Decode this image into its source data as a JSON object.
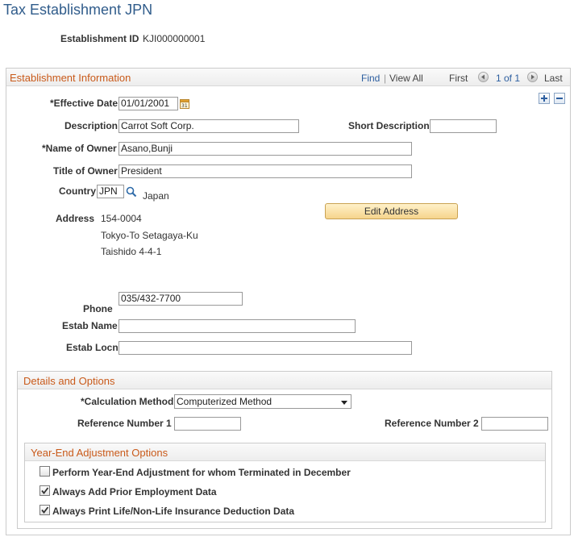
{
  "page": {
    "title": "Tax Establishment JPN"
  },
  "establishment": {
    "id_label": "Establishment ID",
    "id_value": "KJI000000001"
  },
  "info_section": {
    "title": "Establishment Information",
    "nav": {
      "find": "Find",
      "separator": "|",
      "view_all": "View All",
      "first": "First",
      "count": "1 of 1",
      "last": "Last"
    },
    "effective_date": {
      "label": "*Effective Date",
      "value": "01/01/2001"
    },
    "description": {
      "label": "Description",
      "value": "Carrot Soft Corp."
    },
    "short_description": {
      "label": "Short Description",
      "value": ""
    },
    "owner_name": {
      "label": "*Name of Owner",
      "value": "Asano,Bunji"
    },
    "owner_title": {
      "label": "Title of Owner",
      "value": "President"
    },
    "country": {
      "label": "Country",
      "code": "JPN",
      "name": "Japan"
    },
    "address": {
      "label": "Address",
      "lines": [
        "154-0004",
        "Tokyo-To Setagaya-Ku",
        "Taishido 4-4-1"
      ]
    },
    "edit_address_button": "Edit Address",
    "phone": {
      "label": "Phone",
      "value": "035/432-7700"
    },
    "estab_name": {
      "label": "Estab Name",
      "value": ""
    },
    "estab_locn": {
      "label": "Estab Locn",
      "value": ""
    }
  },
  "details_section": {
    "title": "Details and Options",
    "calculation_method": {
      "label": "*Calculation Method",
      "value": "Computerized Method"
    },
    "reference_number_1": {
      "label": "Reference Number 1",
      "value": ""
    },
    "reference_number_2": {
      "label": "Reference Number 2",
      "value": ""
    }
  },
  "year_end_section": {
    "title": "Year-End Adjustment Options",
    "options": [
      {
        "label": "Perform Year-End Adjustment for whom Terminated in December",
        "checked": false
      },
      {
        "label": "Always Add Prior Employment Data",
        "checked": true
      },
      {
        "label": "Always Print Life/Non-Life Insurance Deduction Data",
        "checked": true
      }
    ]
  },
  "icons": {
    "calendar": "calendar-icon",
    "lookup": "magnifier-icon",
    "add_row": "plus-icon",
    "delete_row": "minus-icon",
    "prev": "triangle-left-icon",
    "next": "triangle-right-icon",
    "dropdown": "triangle-down-icon",
    "check": "check-icon"
  },
  "colors": {
    "title": "#305c8b",
    "section_title": "#c95a1a",
    "link": "#2d5fa0",
    "button_fill": "#f6d48c"
  }
}
